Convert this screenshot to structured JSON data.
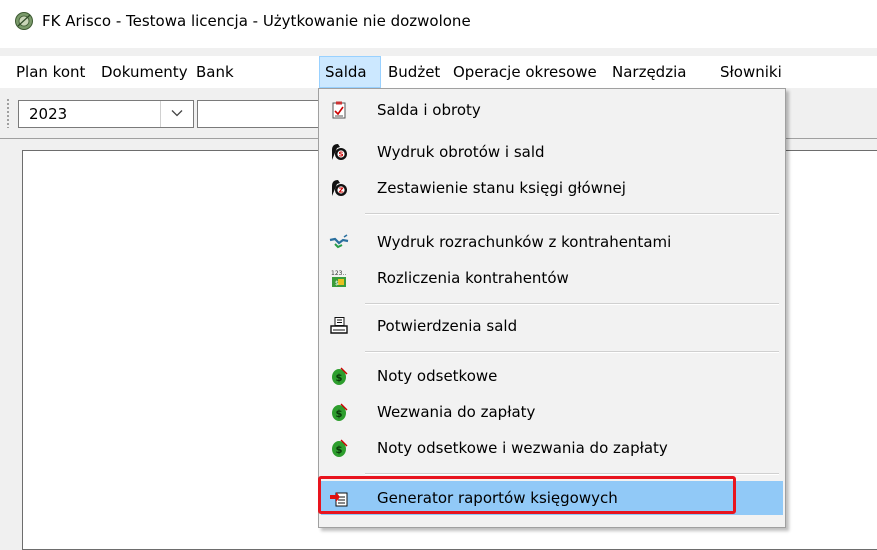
{
  "window": {
    "title": "FK Arisco - Testowa licencja - Użytkowanie nie dozwolone",
    "icon": "app-seal-icon"
  },
  "menubar": {
    "items": [
      {
        "label": "Plan kont"
      },
      {
        "label": "Dokumenty"
      },
      {
        "label": "Bank"
      },
      {
        "label": "Salda",
        "active": true
      },
      {
        "label": "Budżet"
      },
      {
        "label": "Operacje okresowe"
      },
      {
        "label": "Narzędzia"
      },
      {
        "label": "Słowniki"
      }
    ]
  },
  "toolbar": {
    "year": {
      "value": "2023",
      "icon": "chevron-down-icon"
    }
  },
  "salda_menu": {
    "items": [
      {
        "label": "Salda i obroty",
        "icon": "checklist-icon"
      },
      {
        "label": "Wydruk obrotów i sald",
        "icon": "bag-s-icon"
      },
      {
        "label": "Zestawienie stanu księgi głównej",
        "icon": "bag-z-icon"
      },
      {
        "label": "Wydruk rozrachunków z kontrahentami",
        "icon": "handshake-icon"
      },
      {
        "label": "Rozliczenia kontrahentów",
        "icon": "calculator-123-icon"
      },
      {
        "label": "Potwierdzenia sald",
        "icon": "printer-icon"
      },
      {
        "label": "Noty odsetkowe",
        "icon": "money-note-icon"
      },
      {
        "label": "Wezwania do zapłaty",
        "icon": "money-note-icon"
      },
      {
        "label": "Noty odsetkowe i wezwania do zapłaty",
        "icon": "money-note-icon"
      },
      {
        "label": "Generator raportów księgowych",
        "icon": "report-generator-icon",
        "highlighted": true
      }
    ]
  },
  "colors": {
    "menu_active": "#cce8ff",
    "item_highlight": "#91c9f7",
    "annotation_box": "#e8141e"
  }
}
